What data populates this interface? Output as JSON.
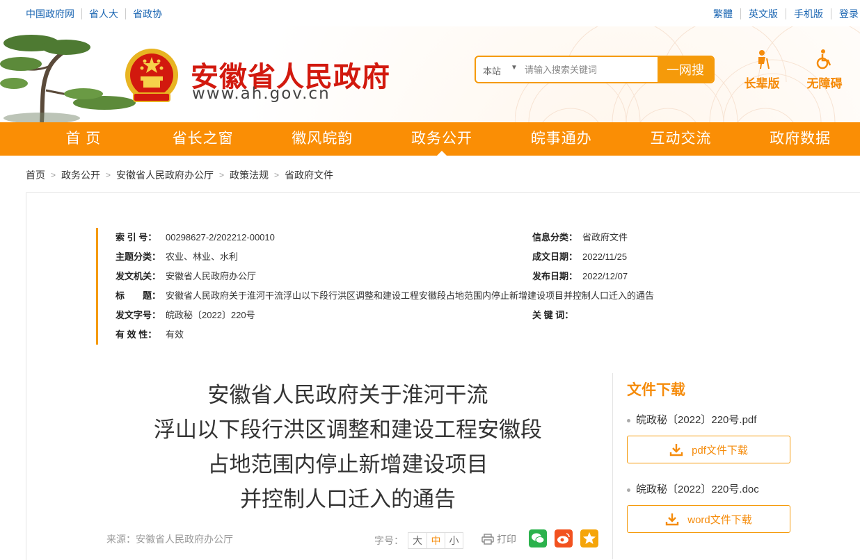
{
  "topbar": {
    "left_links": [
      "中国政府网",
      "省人大",
      "省政协"
    ],
    "right_links": [
      "繁體",
      "英文版",
      "手机版",
      "登录"
    ]
  },
  "header": {
    "site_name": "安徽省人民政府",
    "site_url": "www.ah.gov.cn",
    "search": {
      "scope": "本站",
      "placeholder": "请输入搜索关键词",
      "button": "一网搜"
    },
    "modes": [
      "长辈版",
      "无障碍"
    ]
  },
  "nav": {
    "items": [
      "首 页",
      "省长之窗",
      "徽风皖韵",
      "政务公开",
      "皖事通办",
      "互动交流",
      "政府数据"
    ],
    "active": "政务公开"
  },
  "breadcrumb": [
    "首页",
    "政务公开",
    "安徽省人民政府办公厅",
    "政策法规",
    "省政府文件"
  ],
  "meta": {
    "index_no": {
      "key": "索 引 号：",
      "value": "00298627-2/202212-00010"
    },
    "category": {
      "key": "信息分类：",
      "value": "省政府文件"
    },
    "topic": {
      "key": "主题分类：",
      "value": "农业、林业、水利"
    },
    "created": {
      "key": "成文日期：",
      "value": "2022/11/25"
    },
    "issuer": {
      "key": "发文机关：",
      "value": "安徽省人民政府办公厅"
    },
    "published": {
      "key": "发布日期：",
      "value": "2022/12/07"
    },
    "title": {
      "key": "标　　题：",
      "value": "安徽省人民政府关于淮河干流浮山以下段行洪区调整和建设工程安徽段占地范围内停止新增建设项目并控制人口迁入的通告"
    },
    "doc_no": {
      "key": "发文字号：",
      "value": "皖政秘〔2022〕220号"
    },
    "keywords": {
      "key": "关 键 词：",
      "value": ""
    },
    "validity": {
      "key": "有 效 性：",
      "value": "有效"
    }
  },
  "document": {
    "title_lines": [
      "安徽省人民政府关于淮河干流",
      "浮山以下段行洪区调整和建设工程安徽段",
      "占地范围内停止新增建设项目",
      "并控制人口迁入的通告"
    ],
    "source": "来源：安徽省人民政府办公厅",
    "font_size_label": "字号：",
    "font_sizes": [
      "大",
      "中",
      "小"
    ],
    "print": "打印"
  },
  "download": {
    "title": "文件下载",
    "files": [
      {
        "name": "皖政秘〔2022〕220号.pdf",
        "button": "pdf文件下载"
      },
      {
        "name": "皖政秘〔2022〕220号.doc",
        "button": "word文件下载"
      }
    ]
  },
  "colors": {
    "brand_orange": "#fa8e05",
    "title_red": "#d2190e",
    "link_blue": "#1a65b2"
  }
}
